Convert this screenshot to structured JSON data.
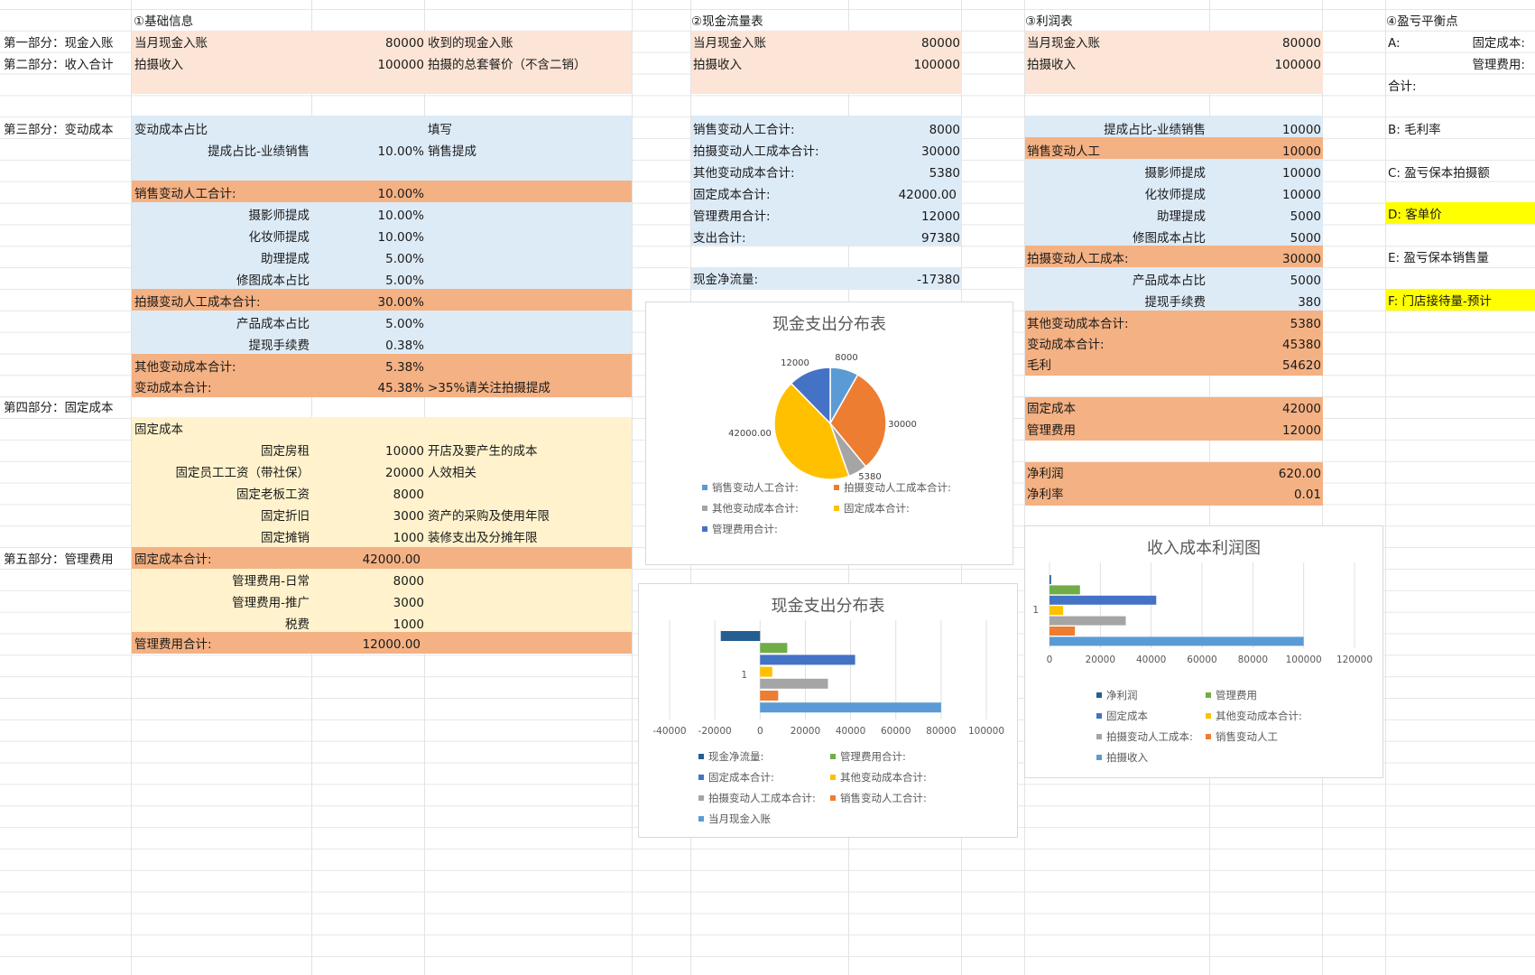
{
  "colors": {
    "peach": "#fce4d6",
    "lightblue": "#ddebf7",
    "orange": "#f4b183",
    "cream": "#fff2cc",
    "yellow": "#ffff00",
    "c1": "#5b9bd5",
    "c2": "#ed7d31",
    "c3": "#a5a5a5",
    "c4": "#ffc000",
    "c5": "#4472c4",
    "c6": "#70ad47",
    "c7": "#255e91"
  },
  "sections": {
    "part1": "第一部分：现金入账",
    "part2": "第二部分：收入合计",
    "part3": "第三部分：变动成本",
    "part4": "第四部分：固定成本",
    "part5": "第五部分：管理费用"
  },
  "basic": {
    "title": "①基础信息",
    "r1": {
      "label": "当月现金入账",
      "value": "80000",
      "note": "收到的现金入账"
    },
    "r2": {
      "label": "拍摄收入",
      "value": "100000",
      "note": "拍摄的总套餐价（不含二销）"
    },
    "r3": {
      "label": "变动成本占比",
      "note": "填写"
    },
    "r4": {
      "label": "提成占比-业绩销售",
      "value": "10.00%",
      "note": "销售提成"
    },
    "r5": {
      "label": "销售变动人工合计:",
      "value": "10.00%"
    },
    "r6": {
      "label": "摄影师提成",
      "value": "10.00%"
    },
    "r7": {
      "label": "化妆师提成",
      "value": "10.00%"
    },
    "r8": {
      "label": "助理提成",
      "value": "5.00%"
    },
    "r9": {
      "label": "修图成本占比",
      "value": "5.00%"
    },
    "r10": {
      "label": "拍摄变动人工成本合计:",
      "value": "30.00%"
    },
    "r11": {
      "label": "产品成本占比",
      "value": "5.00%"
    },
    "r12": {
      "label": "提现手续费",
      "value": "0.38%"
    },
    "r13": {
      "label": "其他变动成本合计:",
      "value": "5.38%"
    },
    "r14": {
      "label": "变动成本合计:",
      "value": "45.38%",
      "note": ">35%请关注拍摄提成"
    },
    "r15": {
      "label": "固定成本"
    },
    "r16": {
      "label": "固定房租",
      "value": "10000",
      "note": "开店及要产生的成本"
    },
    "r17": {
      "label": "固定员工工资（带社保）",
      "value": "20000",
      "note": "人效相关"
    },
    "r18": {
      "label": "固定老板工资",
      "value": "8000"
    },
    "r19": {
      "label": "固定折旧",
      "value": "3000",
      "note": "资产的采购及使用年限"
    },
    "r20": {
      "label": "固定摊销",
      "value": "1000",
      "note": "装修支出及分摊年限"
    },
    "r21": {
      "label": "固定成本合计:",
      "value": "42000.00"
    },
    "r22": {
      "label": "管理费用-日常",
      "value": "8000"
    },
    "r23": {
      "label": "管理费用-推广",
      "value": "3000"
    },
    "r24": {
      "label": "税费",
      "value": "1000"
    },
    "r25": {
      "label": "管理费用合计:",
      "value": "12000.00"
    }
  },
  "cash": {
    "title": "②现金流量表",
    "r1": {
      "label": "当月现金入账",
      "value": "80000"
    },
    "r2": {
      "label": "拍摄收入",
      "value": "100000"
    },
    "r3": {
      "label": "销售变动人工合计:",
      "value": "8000"
    },
    "r4": {
      "label": "拍摄变动人工成本合计:",
      "value": "30000"
    },
    "r5": {
      "label": "其他变动成本合计:",
      "value": "5380"
    },
    "r6": {
      "label": "固定成本合计:",
      "value": "42000.00"
    },
    "r7": {
      "label": "管理费用合计:",
      "value": "12000"
    },
    "r8": {
      "label": "支出合计:",
      "value": "97380"
    },
    "r9": {
      "label": "现金净流量:",
      "value": "-17380"
    }
  },
  "profit": {
    "title": "③利润表",
    "r1": {
      "label": "当月现金入账",
      "value": "80000"
    },
    "r2": {
      "label": "拍摄收入",
      "value": "100000"
    },
    "r3": {
      "label": "提成占比-业绩销售",
      "value": "10000"
    },
    "r4": {
      "label": "销售变动人工",
      "value": "10000"
    },
    "r5": {
      "label": "摄影师提成",
      "value": "10000"
    },
    "r6": {
      "label": "化妆师提成",
      "value": "10000"
    },
    "r7": {
      "label": "助理提成",
      "value": "5000"
    },
    "r8": {
      "label": "修图成本占比",
      "value": "5000"
    },
    "r9": {
      "label": "拍摄变动人工成本:",
      "value": "30000"
    },
    "r10": {
      "label": "产品成本占比",
      "value": "5000"
    },
    "r11": {
      "label": "提现手续费",
      "value": "380"
    },
    "r12": {
      "label": "其他变动成本合计:",
      "value": "5380"
    },
    "r13": {
      "label": "变动成本合计:",
      "value": "45380"
    },
    "r14": {
      "label": "毛利",
      "value": "54620"
    },
    "r15": {
      "label": "固定成本",
      "value": "42000"
    },
    "r16": {
      "label": "管理费用",
      "value": "12000"
    },
    "r17": {
      "label": "净利润",
      "value": "620.00"
    },
    "r18": {
      "label": "净利率",
      "value": "0.01"
    }
  },
  "breakeven": {
    "title": "④盈亏平衡点",
    "a": "A:",
    "a1": "固定成本:",
    "a2": "管理费用:",
    "sum": "合计:",
    "b": "B:  毛利率",
    "c": "C:  盈亏保本拍摄额",
    "d": "D:  客单价",
    "e": "E:  盈亏保本销售量",
    "f": "F:  门店接待量-预计"
  },
  "chart_data": [
    {
      "type": "pie",
      "title": "现金支出分布表",
      "categories": [
        "销售变动人工合计:",
        "拍摄变动人工成本合计:",
        "其他变动成本合计:",
        "固定成本合计:",
        "管理费用合计:"
      ],
      "values": [
        8000,
        30000,
        5380,
        42000,
        12000
      ],
      "data_labels": [
        "8000",
        "30000",
        "5380",
        "42000.00",
        "12000"
      ],
      "legend": "bottom"
    },
    {
      "type": "bar",
      "title": "现金支出分布表",
      "orientation": "horizontal",
      "categories": [
        "1"
      ],
      "series": [
        {
          "name": "现金净流量:",
          "values": [
            -17380
          ]
        },
        {
          "name": "管理费用合计:",
          "values": [
            12000
          ]
        },
        {
          "name": "固定成本合计:",
          "values": [
            42000
          ]
        },
        {
          "name": "其他变动成本合计:",
          "values": [
            5380
          ]
        },
        {
          "name": "拍摄变动人工成本合计:",
          "values": [
            30000
          ]
        },
        {
          "name": "销售变动人工合计:",
          "values": [
            8000
          ]
        },
        {
          "name": "当月现金入账",
          "values": [
            80000
          ]
        }
      ],
      "xlim": [
        -40000,
        100000
      ],
      "xticks": [
        "-40000",
        "-20000",
        "0",
        "20000",
        "40000",
        "60000",
        "80000",
        "100000"
      ],
      "legend": "bottom"
    },
    {
      "type": "bar",
      "title": "收入成本利润图",
      "orientation": "horizontal",
      "categories": [
        "1"
      ],
      "series": [
        {
          "name": "净利润",
          "values": [
            620
          ]
        },
        {
          "name": "管理费用",
          "values": [
            12000
          ]
        },
        {
          "name": "固定成本",
          "values": [
            42000
          ]
        },
        {
          "name": "其他变动成本合计:",
          "values": [
            5380
          ]
        },
        {
          "name": "拍摄变动人工成本:",
          "values": [
            30000
          ]
        },
        {
          "name": "销售变动人工",
          "values": [
            10000
          ]
        },
        {
          "name": "拍摄收入",
          "values": [
            100000
          ]
        }
      ],
      "xlim": [
        0,
        120000
      ],
      "xticks": [
        "0",
        "20000",
        "40000",
        "60000",
        "80000",
        "100000",
        "120000"
      ],
      "legend": "bottom"
    }
  ]
}
